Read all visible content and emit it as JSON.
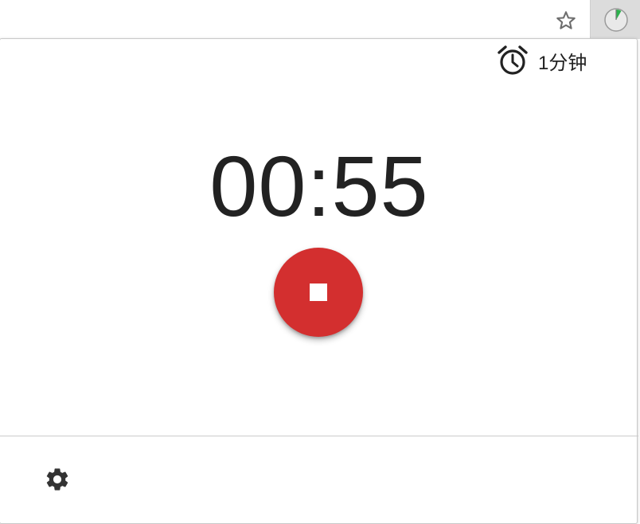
{
  "browser_toolbar": {
    "bookmark_icon": "star-outline-icon",
    "extension_icon": "timer-progress-icon",
    "extension_progress_fraction": 0.083,
    "extension_progress_color": "#2bb24c"
  },
  "popup": {
    "duration": {
      "icon": "alarm-clock-icon",
      "label": "1分钟"
    },
    "timer": {
      "display": "00:55"
    },
    "stop_button": {
      "icon": "stop-icon",
      "color": "#d32f2f"
    },
    "footer": {
      "settings_icon": "gear-icon"
    }
  }
}
